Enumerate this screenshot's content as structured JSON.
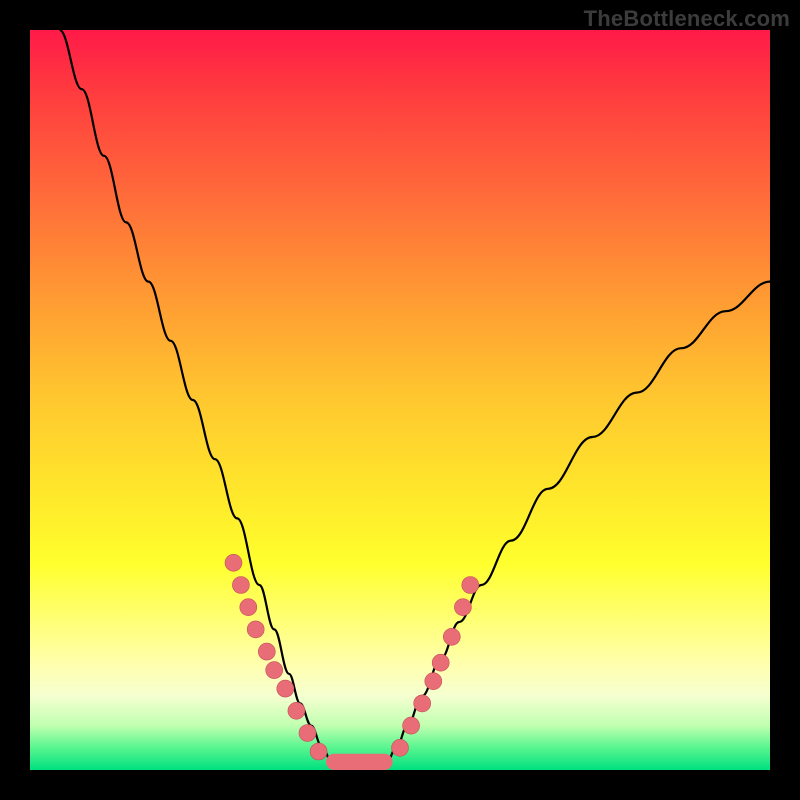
{
  "watermark": "TheBottleneck.com",
  "chart_data": {
    "type": "line",
    "title": "",
    "xlabel": "",
    "ylabel": "",
    "xlim": [
      0,
      100
    ],
    "ylim": [
      0,
      100
    ],
    "grid": false,
    "legend": false,
    "curves": [
      {
        "name": "left-curve",
        "x": [
          4,
          7,
          10,
          13,
          16,
          19,
          22,
          25,
          28,
          31,
          33,
          35,
          36.5,
          38,
          39.5,
          41
        ],
        "y": [
          100,
          92,
          83,
          74,
          66,
          58,
          50,
          42,
          34,
          25,
          19,
          13,
          9,
          6,
          3,
          0.5
        ]
      },
      {
        "name": "right-curve",
        "x": [
          48,
          49.5,
          51,
          53,
          55.5,
          58,
          61,
          65,
          70,
          76,
          82,
          88,
          94,
          100
        ],
        "y": [
          0.5,
          3,
          6,
          10,
          15,
          20,
          25,
          31,
          38,
          45,
          51,
          57,
          62,
          66
        ]
      }
    ],
    "scatter": [
      {
        "x": 27.5,
        "y": 28.0
      },
      {
        "x": 28.5,
        "y": 25.0
      },
      {
        "x": 29.5,
        "y": 22.0
      },
      {
        "x": 30.5,
        "y": 19.0
      },
      {
        "x": 32.0,
        "y": 16.0
      },
      {
        "x": 33.0,
        "y": 13.5
      },
      {
        "x": 34.5,
        "y": 11.0
      },
      {
        "x": 36.0,
        "y": 8.0
      },
      {
        "x": 37.5,
        "y": 5.0
      },
      {
        "x": 39.0,
        "y": 2.5
      },
      {
        "x": 50.0,
        "y": 3.0
      },
      {
        "x": 51.5,
        "y": 6.0
      },
      {
        "x": 53.0,
        "y": 9.0
      },
      {
        "x": 54.5,
        "y": 12.0
      },
      {
        "x": 55.5,
        "y": 14.5
      },
      {
        "x": 57.0,
        "y": 18.0
      },
      {
        "x": 58.5,
        "y": 22.0
      },
      {
        "x": 59.5,
        "y": 25.0
      }
    ],
    "floor_bar": {
      "x_start": 40,
      "x_end": 49,
      "height": 2.2
    }
  }
}
